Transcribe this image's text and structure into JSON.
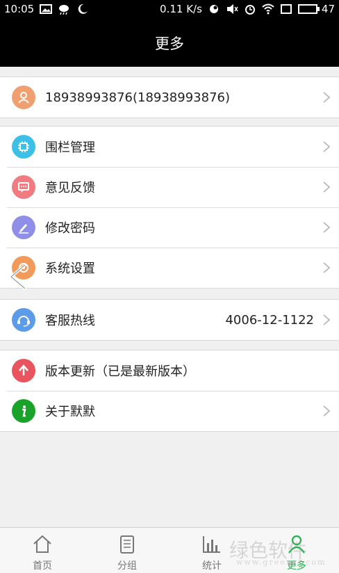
{
  "status_bar": {
    "time": "10:05",
    "net_speed": "0.11 K/s",
    "battery": "47"
  },
  "header": {
    "title": "更多"
  },
  "account": {
    "label": "18938993876(18938993876)"
  },
  "menu": {
    "fence": "围栏管理",
    "feedback": "意见反馈",
    "password": "修改密码",
    "settings": "系统设置"
  },
  "service": {
    "label": "客服热线",
    "phone": "4006-12-1122"
  },
  "about_section": {
    "update": "版本更新（已是最新版本）",
    "about": "关于默默"
  },
  "tabs": [
    {
      "label": "首页",
      "icon": "home-icon"
    },
    {
      "label": "分组",
      "icon": "clipboard-icon"
    },
    {
      "label": "统计",
      "icon": "bar-chart-icon"
    },
    {
      "label": "更多",
      "icon": "user-icon"
    }
  ],
  "watermark": {
    "text": "绿色软件",
    "sub": "www.greenxf.com"
  },
  "colors": {
    "active_tab": "#22b14c",
    "account_icon": "#f0a070",
    "fence_icon": "#3cc0e8",
    "feedback_icon": "#f07b80",
    "password_icon": "#8f8fe8",
    "settings_icon": "#f29a5a",
    "service_icon": "#5b9be8",
    "update_icon": "#e8555f",
    "about_icon": "#1aa32a"
  }
}
